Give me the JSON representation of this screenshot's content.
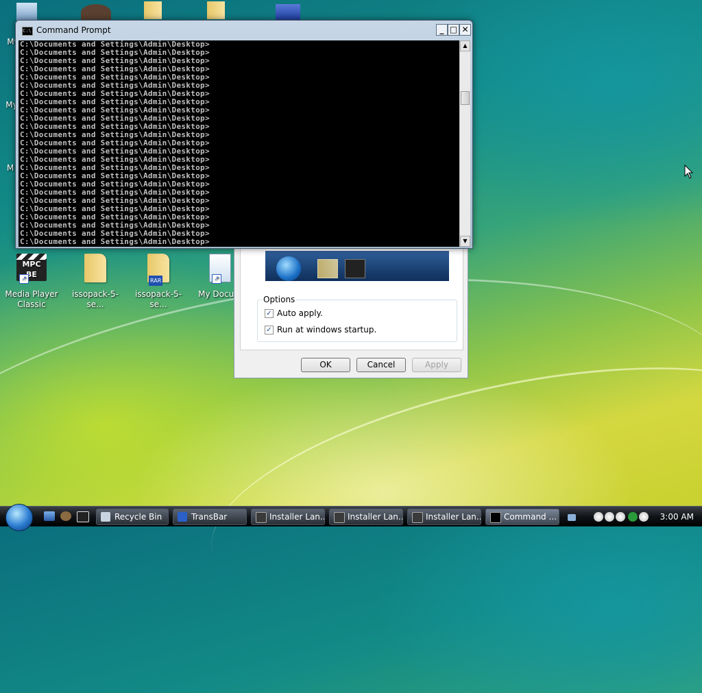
{
  "desktop": {
    "icons_top": [
      {
        "label": "My"
      },
      {
        "label": "My"
      },
      {
        "label": "M"
      }
    ],
    "icons_bottom": [
      {
        "label": "Media Player Classic",
        "badge": "MPC BE"
      },
      {
        "label": "issopack-5-se..."
      },
      {
        "label": "issopack-5-se...",
        "badge": "RAR"
      },
      {
        "label": "My Docum"
      }
    ]
  },
  "cmd_window": {
    "title": "Command Prompt",
    "minimize": "_",
    "maximize": "□",
    "close": "✕",
    "icon_text": "C:\\",
    "lines": [
      "C:\\Documents and Settings\\Admin\\Desktop>",
      "C:\\Documents and Settings\\Admin\\Desktop>",
      "C:\\Documents and Settings\\Admin\\Desktop>",
      "C:\\Documents and Settings\\Admin\\Desktop>",
      "C:\\Documents and Settings\\Admin\\Desktop>",
      "C:\\Documents and Settings\\Admin\\Desktop>",
      "C:\\Documents and Settings\\Admin\\Desktop>",
      "C:\\Documents and Settings\\Admin\\Desktop>",
      "C:\\Documents and Settings\\Admin\\Desktop>",
      "C:\\Documents and Settings\\Admin\\Desktop>",
      "C:\\Documents and Settings\\Admin\\Desktop>",
      "C:\\Documents and Settings\\Admin\\Desktop>",
      "C:\\Documents and Settings\\Admin\\Desktop>",
      "C:\\Documents and Settings\\Admin\\Desktop>",
      "C:\\Documents and Settings\\Admin\\Desktop>",
      "C:\\Documents and Settings\\Admin\\Desktop>",
      "C:\\Documents and Settings\\Admin\\Desktop>",
      "C:\\Documents and Settings\\Admin\\Desktop>",
      "C:\\Documents and Settings\\Admin\\Desktop>",
      "C:\\Documents and Settings\\Admin\\Desktop>",
      "C:\\Documents and Settings\\Admin\\Desktop>",
      "C:\\Documents and Settings\\Admin\\Desktop>",
      "C:\\Documents and Settings\\Admin\\Desktop>",
      "C:\\Documents and Settings\\Admin\\Desktop>",
      "C:\\Documents and Settings\\Admin\\Desktop>"
    ]
  },
  "dialog": {
    "options_label": "Options",
    "auto_apply_label": "Auto apply.",
    "auto_apply_checked": true,
    "run_startup_label": "Run at windows startup.",
    "run_startup_checked": true,
    "ok_label": "OK",
    "cancel_label": "Cancel",
    "apply_label": "Apply"
  },
  "taskbar": {
    "tasks": [
      {
        "label": "Recycle Bin",
        "icon": "recycle-bin-icon"
      },
      {
        "label": "TransBar",
        "icon": "window-icon"
      },
      {
        "label": "Installer Lan...",
        "icon": "installer-icon"
      },
      {
        "label": "Installer Lan...",
        "icon": "installer-icon"
      },
      {
        "label": "Installer Lan...",
        "icon": "installer-icon"
      },
      {
        "label": "Command ...",
        "icon": "cmd-icon"
      }
    ],
    "clock": "3:00 AM"
  }
}
